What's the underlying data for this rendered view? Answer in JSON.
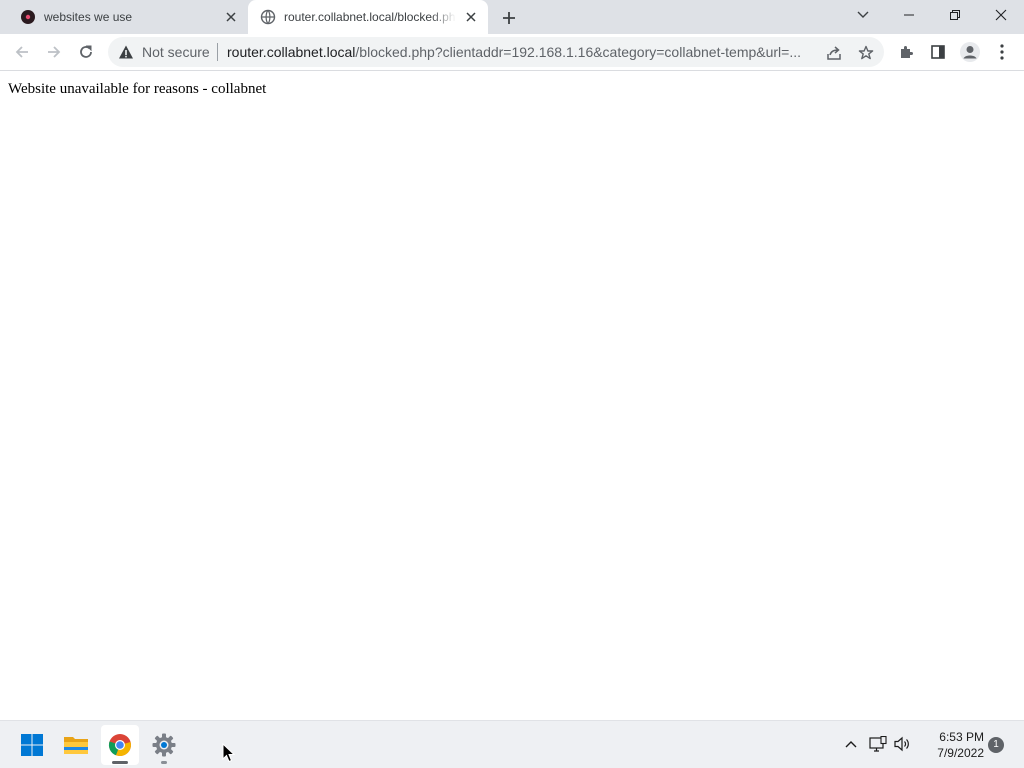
{
  "tabs": [
    {
      "title": "websites we use",
      "active": false,
      "favicon": "dark-circle-icon"
    },
    {
      "title": "router.collabnet.local/blocked.php?clientaddr=192.168.1.16&category=collabnet-temp",
      "active": true,
      "favicon": "globe-icon"
    }
  ],
  "window_controls": [
    "tab-search-icon",
    "minimize-icon",
    "restore-icon",
    "close-icon"
  ],
  "toolbar": {
    "security_label": "Not secure",
    "url_host": "router.collabnet.local",
    "url_rest": "/blocked.php?clientaddr=192.168.1.16&category=collabnet-temp&url=..."
  },
  "page": {
    "message": "Website unavailable for reasons - collabnet"
  },
  "taskbar": {
    "apps": [
      "windows-start-icon",
      "file-explorer-icon",
      "chrome-icon",
      "settings-icon"
    ],
    "time": "6:53 PM",
    "date": "7/9/2022",
    "notification_count": "1"
  },
  "colors": {
    "tabstrip_bg": "#dee1e6",
    "omnibox_bg": "#f1f3f4",
    "taskbar_bg": "#eef0f3",
    "windows_blue": "#0078d4"
  }
}
